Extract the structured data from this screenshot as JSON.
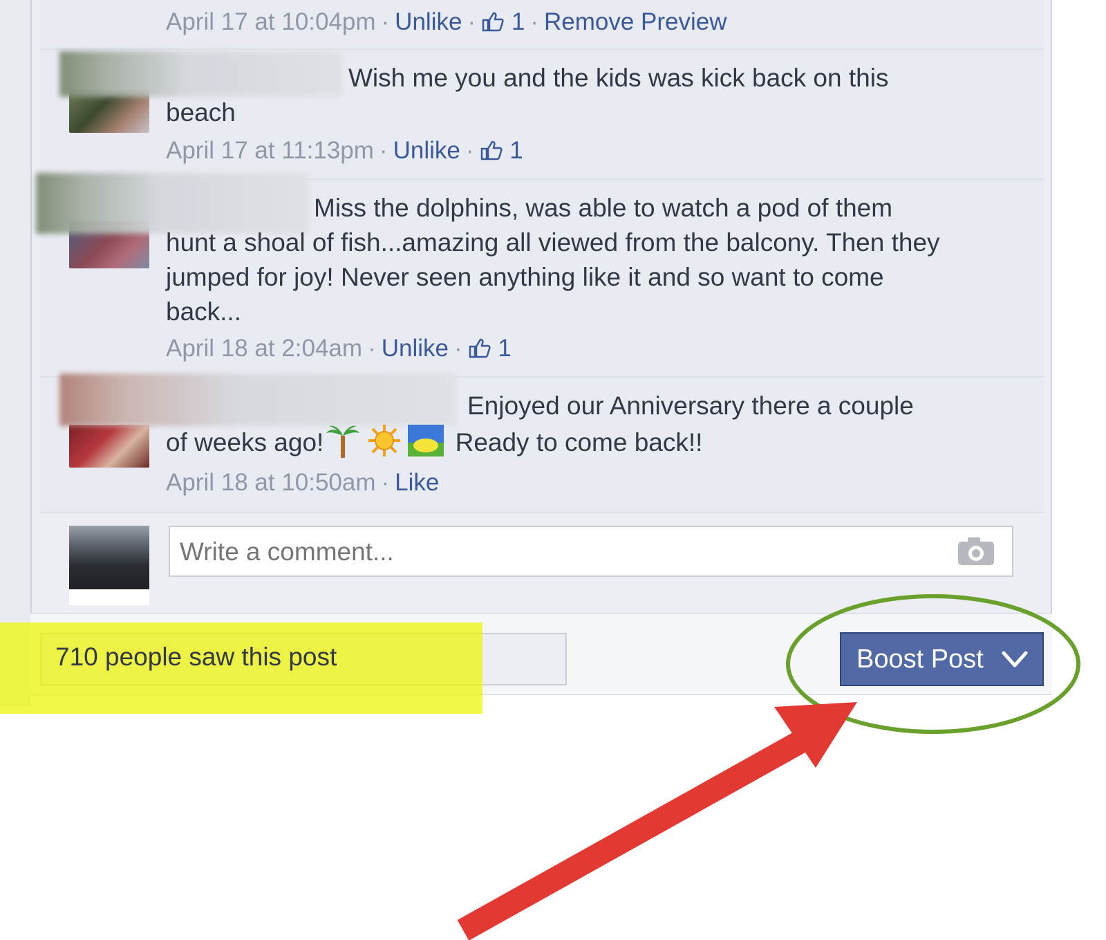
{
  "comments": [
    {
      "meta": {
        "time": "April 17 at 10:04pm",
        "unlike": "Unlike",
        "likes": "1",
        "remove_preview": "Remove Preview"
      }
    },
    {
      "text_first": "Wish me you and the kids was kick back on this",
      "text_rest": "beach",
      "meta": {
        "time": "April 17 at 11:13pm",
        "unlike": "Unlike",
        "likes": "1"
      }
    },
    {
      "text_first": "Miss the dolphins, was able to watch a pod of them",
      "text_rest_lines": [
        "hunt a shoal of fish...amazing all viewed from the balcony. Then they",
        "jumped for joy! Never seen anything like it and so want to come",
        "back..."
      ],
      "meta": {
        "time": "April 18 at 2:04am",
        "unlike": "Unlike",
        "likes": "1"
      }
    },
    {
      "text_first": "Enjoyed our Anniversary there a couple",
      "text_second_a": "of weeks ago!",
      "text_second_b": "Ready to come back!!",
      "emoji_names": [
        "palm-tree-icon",
        "sun-icon",
        "sunrise-icon"
      ],
      "meta": {
        "time": "April 18 at 10:50am",
        "like": "Like"
      }
    }
  ],
  "composer": {
    "placeholder": "Write a comment...",
    "icon": "camera-icon"
  },
  "footer": {
    "seen_text": "710 people saw this post",
    "boost_label": "Boost Post"
  },
  "colors": {
    "link": "#3b5998",
    "boost_bg": "#516aa6",
    "highlight": "#ebf500",
    "circle": "#6aa12c",
    "arrow": "#e23a33"
  }
}
